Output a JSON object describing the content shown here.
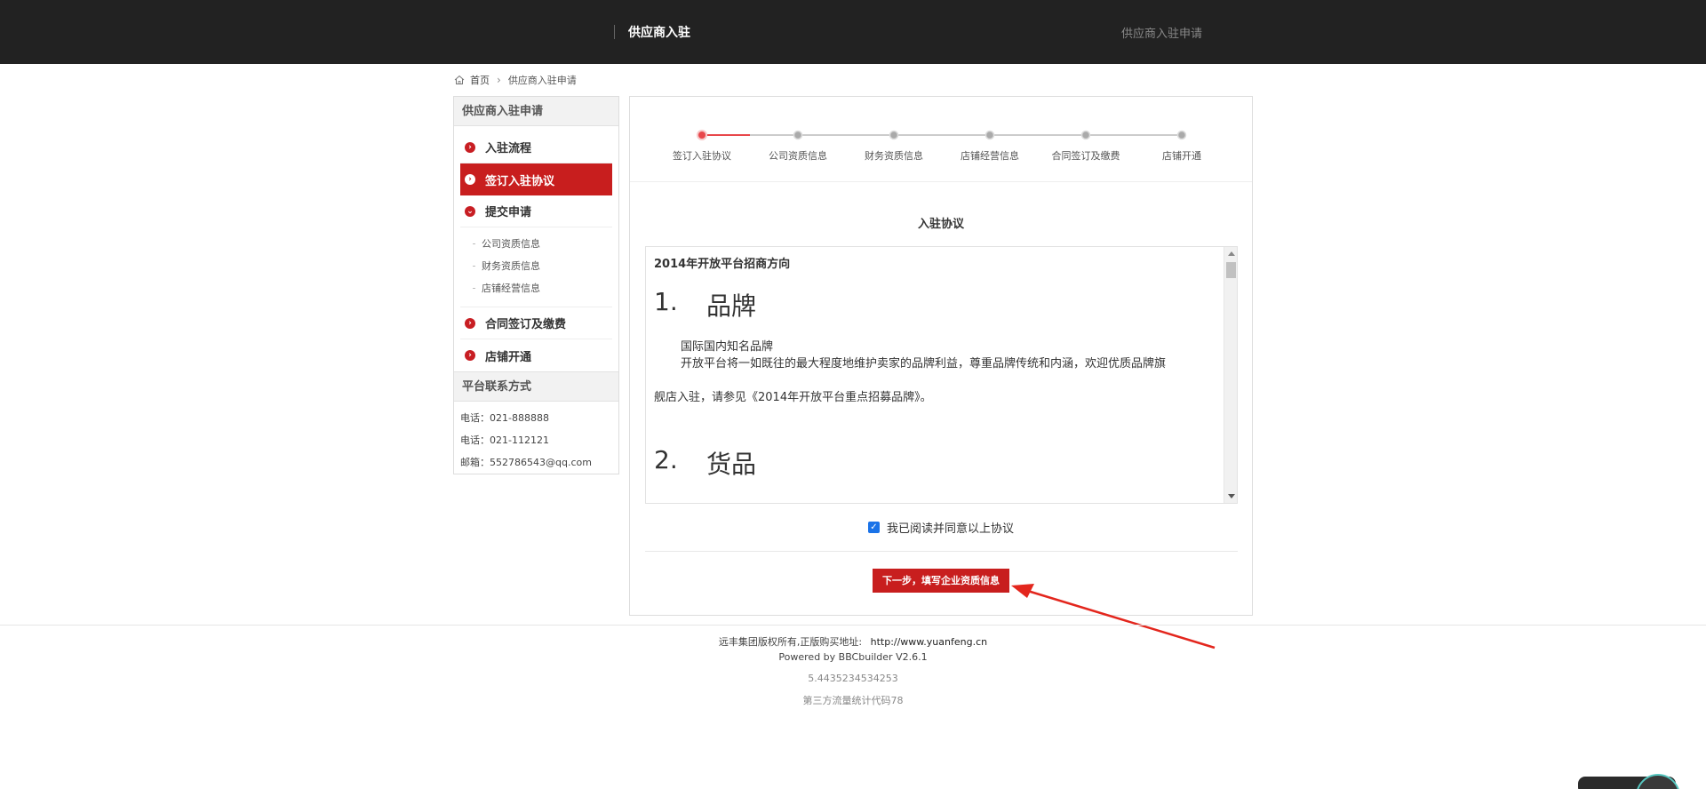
{
  "header": {
    "title": "供应商入驻",
    "right_link": "供应商入驻申请"
  },
  "breadcrumb": {
    "home": "首页",
    "current": "供应商入驻申请"
  },
  "sidebar": {
    "title": "供应商入驻申请",
    "steps": {
      "flow": "入驻流程",
      "sign": "签订入驻协议",
      "submit": "提交申请",
      "contract": "合同签订及缴费",
      "open": "店铺开通"
    },
    "sub_items": [
      "公司资质信息",
      "财务资质信息",
      "店铺经营信息"
    ],
    "contact_title": "平台联系方式",
    "contacts": [
      "电话：021-888888",
      "电话：021-112121",
      "邮箱：552786543@qq.com"
    ]
  },
  "progress": {
    "steps": [
      "签订入驻协议",
      "公司资质信息",
      "财务资质信息",
      "店铺经营信息",
      "合同签订及缴费",
      "店铺开通"
    ],
    "current_index": 0,
    "active_color": "#e8474b",
    "inactive_color": "#bbbbbb"
  },
  "agreement": {
    "title": "入驻协议",
    "heading": "2014年开放平台招商方向",
    "section1_num": "1.",
    "section1_title": "品牌",
    "p1": "国际国内知名品牌",
    "p2": "开放平台将一如既往的最大程度地维护卖家的品牌利益，尊重品牌传统和内涵，欢迎优质品牌旗",
    "p3": "舰店入驻，请参见《2014年开放平台重点招募品牌》。",
    "section2_num": "2.",
    "section2_title": "货品",
    "checkbox_label": "我已阅读并同意以上协议",
    "checked": true,
    "next_button": "下一步，填写企业资质信息"
  },
  "footer": {
    "copyright": "远丰集团版权所有,正版购买地址:",
    "url": "http://www.yuanfeng.cn",
    "powered": "Powered by BBCbuilder V2.6.1",
    "version": "5.4435234534253",
    "stats": "第三方流量统计代码78"
  },
  "colors": {
    "brand_red": "#c81e1e",
    "header_bg": "#222222"
  }
}
